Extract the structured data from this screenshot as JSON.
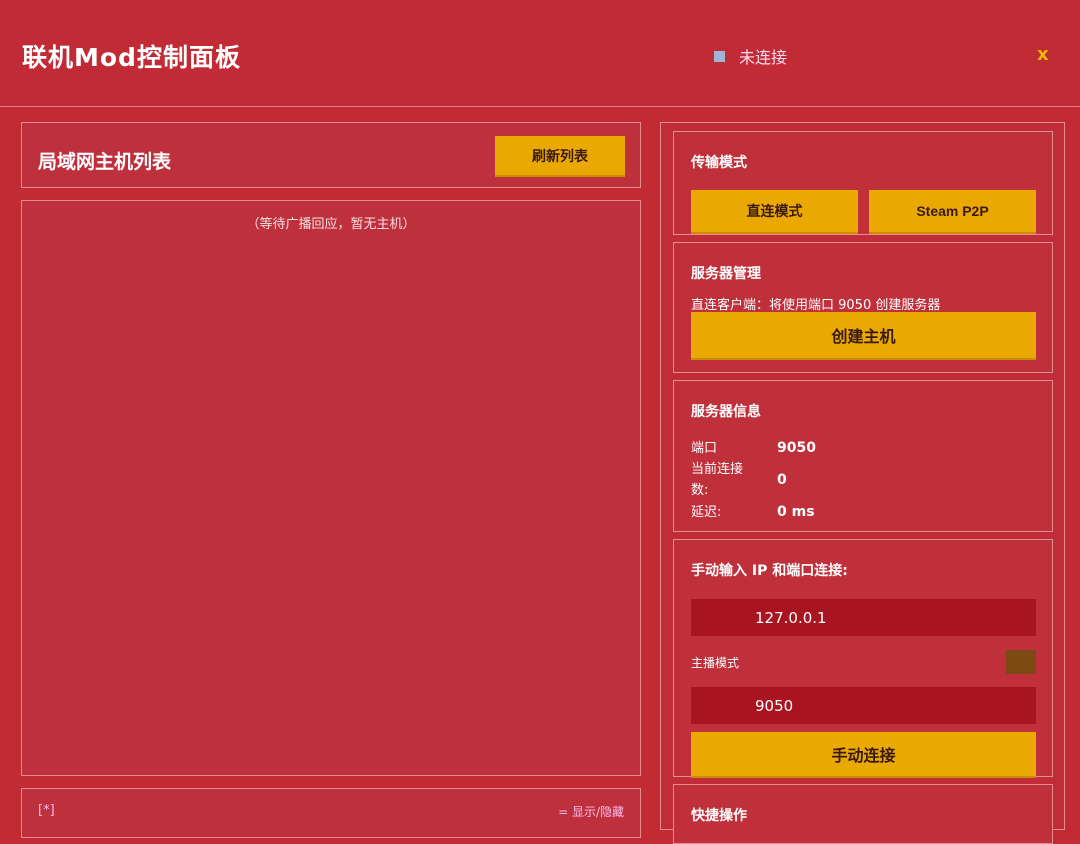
{
  "window": {
    "title": "联机Mod控制面板",
    "status_text": "未连接",
    "close_label": "x"
  },
  "lan": {
    "title": "局域网主机列表",
    "refresh_label": "刷新列表",
    "empty_message": "（等待广播回应，暂无主机）",
    "footer_left": "[*]",
    "footer_right": "= 显示/隐藏"
  },
  "transport": {
    "title": "传输模式",
    "direct_label": "直连模式",
    "steam_label": "Steam P2P"
  },
  "server_mgmt": {
    "title": "服务器管理",
    "desc": "直连客户端：将使用端口 9050 创建服务器",
    "create_label": "创建主机"
  },
  "server_info": {
    "title": "服务器信息",
    "port_label": "端口",
    "port_value": "9050",
    "conn_label": "当前连接数:",
    "conn_value": "0",
    "latency_label": "延迟:",
    "latency_value": "0 ms"
  },
  "manual": {
    "title": "手动输入 IP 和端口连接:",
    "ip_value": "127.0.0.1",
    "streamer_label": "主播模式",
    "port_value": "9050",
    "connect_label": "手动连接"
  },
  "quick": {
    "title": "快捷操作"
  },
  "colors": {
    "background": "#c32a33",
    "accent_yellow": "#eaa900",
    "input_bg": "#a8141f",
    "status_dot": "#9fb4d6"
  }
}
